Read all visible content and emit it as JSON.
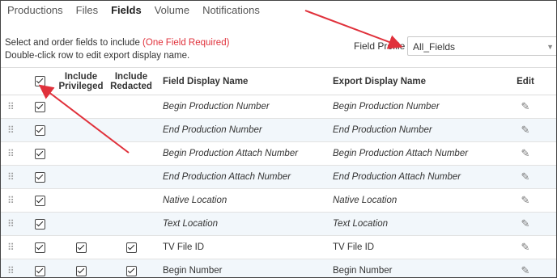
{
  "tabs": [
    {
      "label": "Productions",
      "active": false
    },
    {
      "label": "Files",
      "active": false
    },
    {
      "label": "Fields",
      "active": true
    },
    {
      "label": "Volume",
      "active": false
    },
    {
      "label": "Notifications",
      "active": false
    }
  ],
  "instructions": {
    "line1_prefix": "Select and order fields to include ",
    "line1_required": "(One Field Required)",
    "line2": "Double-click row to edit export display name."
  },
  "profile": {
    "label": "Field Profile",
    "value": "All_Fields"
  },
  "table": {
    "headers": {
      "select_all_checked": true,
      "include_privileged": "Include Privileged",
      "include_redacted": "Include Redacted",
      "field_display_name": "Field Display Name",
      "export_display_name": "Export Display Name",
      "edit": "Edit"
    },
    "rows": [
      {
        "selected": true,
        "privileged": false,
        "redacted": false,
        "field": "Begin Production Number",
        "export": "Begin Production Number",
        "italic": true
      },
      {
        "selected": true,
        "privileged": false,
        "redacted": false,
        "field": "End Production Number",
        "export": "End Production Number",
        "italic": true
      },
      {
        "selected": true,
        "privileged": false,
        "redacted": false,
        "field": "Begin Production Attach Number",
        "export": "Begin Production Attach Number",
        "italic": true
      },
      {
        "selected": true,
        "privileged": false,
        "redacted": false,
        "field": "End Production Attach Number",
        "export": "End Production Attach Number",
        "italic": true
      },
      {
        "selected": true,
        "privileged": false,
        "redacted": false,
        "field": "Native Location",
        "export": "Native Location",
        "italic": true
      },
      {
        "selected": true,
        "privileged": false,
        "redacted": false,
        "field": "Text Location",
        "export": "Text Location",
        "italic": true
      },
      {
        "selected": true,
        "privileged": true,
        "redacted": true,
        "field": "TV File ID",
        "export": "TV File ID",
        "italic": false
      },
      {
        "selected": true,
        "privileged": true,
        "redacted": true,
        "field": "Begin Number",
        "export": "Begin Number",
        "italic": false
      }
    ]
  },
  "colors": {
    "annotation_arrow": "#e0313b",
    "required_text": "#e0313b",
    "alt_row": "#f2f7fb"
  }
}
